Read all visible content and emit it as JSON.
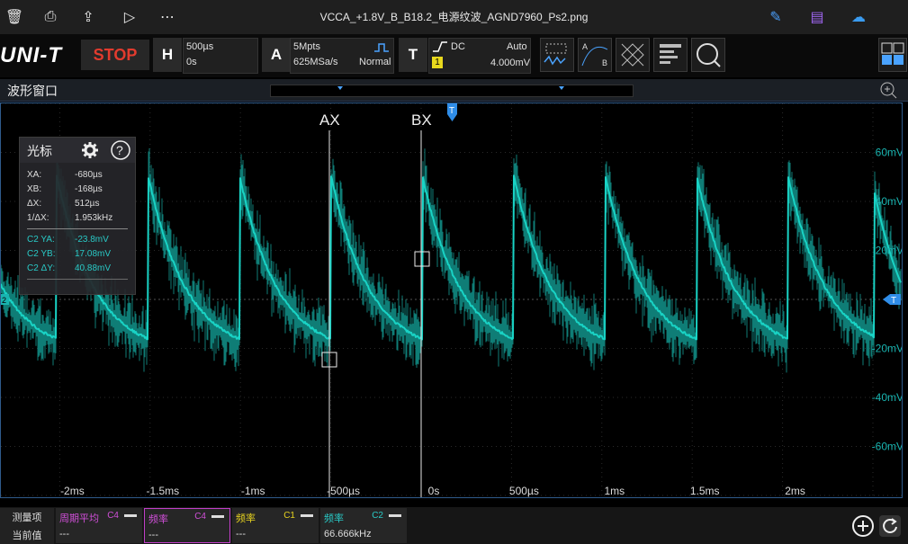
{
  "viewer": {
    "title": "VCCA_+1.8V_B_B18.2_电源纹波_AGND7960_Ps2.png",
    "icons": [
      "trash-icon",
      "print-icon",
      "share-icon",
      "slideshow-icon",
      "more-icon",
      "edit-icon",
      "apps-icon",
      "cloud-icon"
    ]
  },
  "toolbar": {
    "logo": "UNI-T",
    "run_state": "STOP",
    "horizontal": {
      "letter": "H",
      "timebase": "500µs",
      "position": "0s"
    },
    "acquire": {
      "letter": "A",
      "depth": "5Mpts",
      "rate": "625MSa/s",
      "mode": "Normal"
    },
    "trigger": {
      "letter": "T",
      "coupling": "DC",
      "sweep": "Auto",
      "source": "1",
      "level": "4.000mV"
    }
  },
  "window": {
    "title": "波形窗口"
  },
  "cursor_panel": {
    "title": "光标",
    "rows": [
      {
        "k": "XA:",
        "v": "-680µs"
      },
      {
        "k": "XB:",
        "v": "-168µs"
      },
      {
        "k": "ΔX:",
        "v": "512µs"
      },
      {
        "k": "1/ΔX:",
        "v": "1.953kHz"
      }
    ],
    "c2_rows": [
      {
        "k": "C2 YA:",
        "v": "-23.8mV"
      },
      {
        "k": "C2 YB:",
        "v": "17.08mV"
      },
      {
        "k": "C2 ΔY:",
        "v": "40.88mV"
      }
    ]
  },
  "plot": {
    "cursor_a_label": "AX",
    "cursor_b_label": "BX",
    "trigger_marker": "T",
    "channel_marker": "2",
    "waveform_color": "#19d3c5",
    "x_ticks": [
      "-2ms",
      "-1.5ms",
      "-1ms",
      "-500µs",
      "0s",
      "500µs",
      "1ms",
      "1.5ms",
      "2ms"
    ],
    "y_ticks": [
      "60mV",
      "40mV",
      "20mV",
      "-20mV",
      "-40mV",
      "-60mV"
    ]
  },
  "measure": {
    "row1_label": "测量项",
    "row2_label": "当前值",
    "items": [
      {
        "name": "周期平均",
        "channel": "C4",
        "value": "---",
        "color": "#d04fd8",
        "selected": false
      },
      {
        "name": "频率",
        "channel": "C4",
        "value": "---",
        "color": "#d04fd8",
        "selected": true
      },
      {
        "name": "频率",
        "channel": "C1",
        "value": "---",
        "color": "#e6d21f",
        "selected": false
      },
      {
        "name": "频率",
        "channel": "C2",
        "value": "66.666kHz",
        "color": "#29c9c6",
        "selected": false
      }
    ]
  }
}
